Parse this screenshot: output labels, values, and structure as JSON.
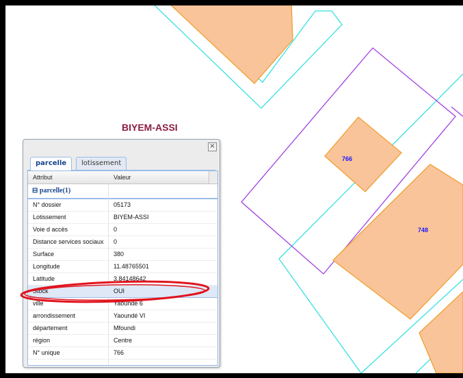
{
  "map": {
    "district_label": "BIYEM-ASSI",
    "parcel_labels": [
      "766",
      "748"
    ],
    "colors": {
      "parcel_fill": "#f9c49a",
      "parcel_stroke": "#f0a030",
      "road": "#36e0e0",
      "block": "#a040e0",
      "label": "#1a1aff"
    }
  },
  "panel": {
    "close_icon": "close-icon",
    "tabs": [
      {
        "label": "parcelle",
        "active": true
      },
      {
        "label": "lotissement",
        "active": false
      }
    ],
    "headers": {
      "attribute": "Attribut",
      "value": "Valeur"
    },
    "group_label": "parcelle(1)",
    "group_icon": "collapse-icon",
    "rows": [
      {
        "attr": "N° dossier",
        "value": "05173"
      },
      {
        "attr": "Lotissement",
        "value": "BIYEM-ASSI"
      },
      {
        "attr": "Voie d accès",
        "value": "0"
      },
      {
        "attr": "Distance services sociaux",
        "value": "0"
      },
      {
        "attr": "Surface",
        "value": "380"
      },
      {
        "attr": "Longitude",
        "value": "11.48765501"
      },
      {
        "attr": "Latitude",
        "value": "3.84148642"
      },
      {
        "attr": "Stock",
        "value": "OUI"
      },
      {
        "attr": "ville",
        "value": "Yaoundé 6"
      },
      {
        "attr": "arrondissement",
        "value": "Yaoundé VI"
      },
      {
        "attr": "département",
        "value": "Mfoundi"
      },
      {
        "attr": "région",
        "value": "Centre"
      },
      {
        "attr": "N° unique",
        "value": "766"
      }
    ]
  }
}
